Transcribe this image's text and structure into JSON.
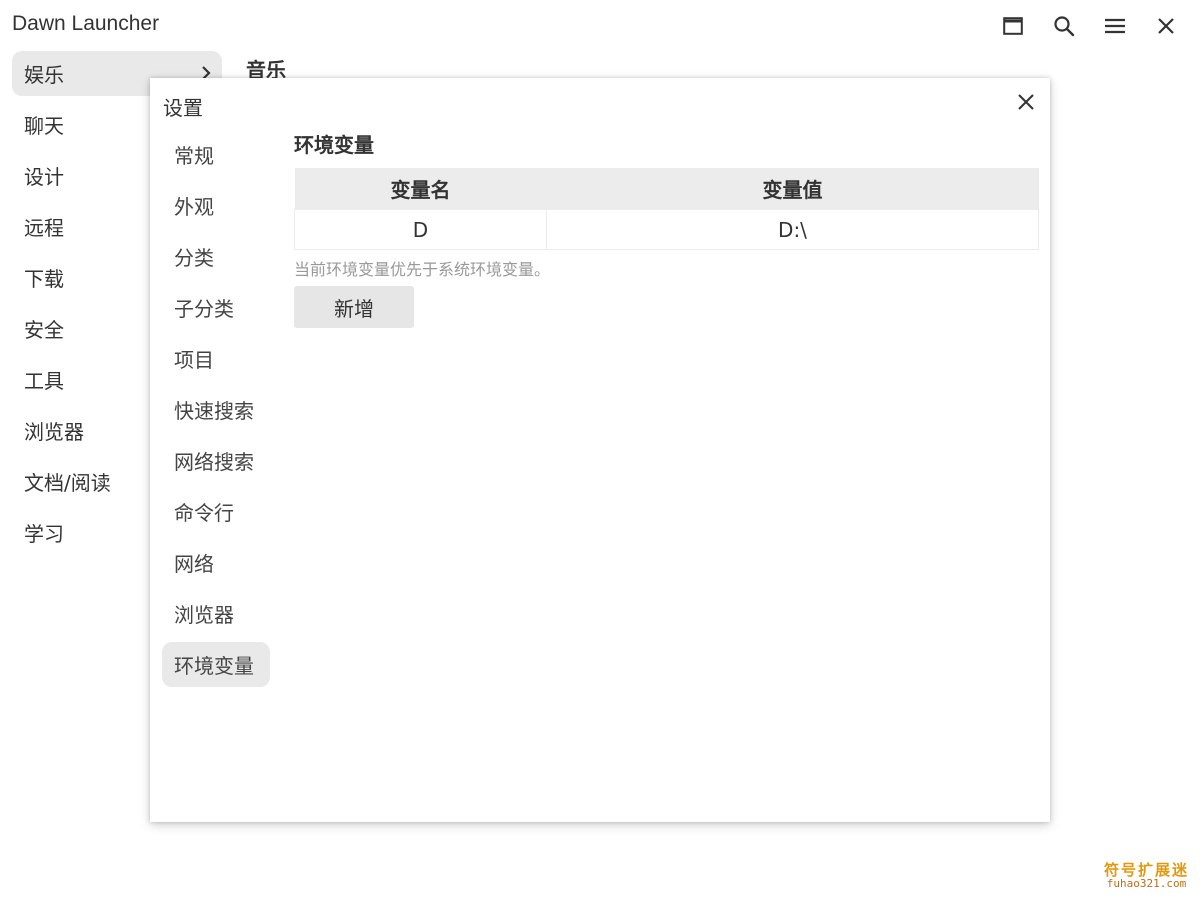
{
  "app": {
    "title": "Dawn Launcher"
  },
  "window_controls": [
    {
      "icon": "maximize-icon"
    },
    {
      "icon": "search-icon"
    },
    {
      "icon": "menu-icon"
    },
    {
      "icon": "close-icon"
    }
  ],
  "sidebar": {
    "items": [
      {
        "label": "娱乐",
        "active": true
      },
      {
        "label": "聊天"
      },
      {
        "label": "设计"
      },
      {
        "label": "远程"
      },
      {
        "label": "下载"
      },
      {
        "label": "安全"
      },
      {
        "label": "工具"
      },
      {
        "label": "浏览器"
      },
      {
        "label": "文档/阅读"
      },
      {
        "label": "学习"
      }
    ]
  },
  "content": {
    "heading": "音乐"
  },
  "dialog": {
    "title": "设置",
    "nav": [
      {
        "label": "常规"
      },
      {
        "label": "外观"
      },
      {
        "label": "分类"
      },
      {
        "label": "子分类"
      },
      {
        "label": "项目"
      },
      {
        "label": "快速搜索"
      },
      {
        "label": "网络搜索"
      },
      {
        "label": "命令行"
      },
      {
        "label": "网络"
      },
      {
        "label": "浏览器"
      },
      {
        "label": "环境变量",
        "active": true
      }
    ],
    "panel": {
      "title": "环境变量",
      "table": {
        "columns": [
          "变量名",
          "变量值"
        ],
        "rows": [
          [
            "D",
            "D:\\"
          ]
        ]
      },
      "hint": "当前环境变量优先于系统环境变量。",
      "add_label": "新增"
    }
  },
  "watermark": {
    "cn": "符号扩展迷",
    "url": "fuhao321.com"
  }
}
